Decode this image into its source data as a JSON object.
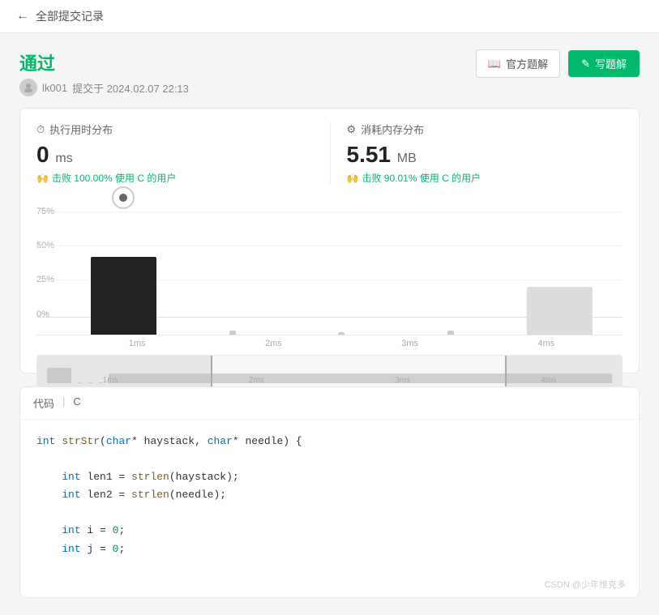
{
  "nav": {
    "back_label": "←",
    "title": "全部提交记录"
  },
  "status": {
    "label": "通过",
    "submitter": "lk001",
    "submitted_text": "提交于 2024.02.07 22:13"
  },
  "buttons": {
    "official_solution": "官方题解",
    "write_solution": "写题解"
  },
  "time_stats": {
    "section_label": "执行用时分布",
    "value": "0",
    "unit": "ms",
    "beat_text": "击败 100.00% 使用 C 的用户"
  },
  "memory_stats": {
    "section_label": "消耗内存分布",
    "value": "5.51",
    "unit": "MB",
    "beat_text": "击败 90.01% 使用 C 的用户"
  },
  "chart": {
    "y_labels": [
      "75%",
      "50%",
      "25%",
      "0%"
    ],
    "x_labels": [
      "1ms",
      "2ms",
      "3ms",
      "4ms"
    ],
    "bars": [
      {
        "height": 57,
        "type": "dark",
        "has_pointer": true
      },
      {
        "height": 3,
        "type": "gray"
      },
      {
        "height": 2,
        "type": "gray"
      },
      {
        "height": 3,
        "type": "gray"
      },
      {
        "height": 35,
        "type": "light-gray"
      }
    ],
    "mini_x_labels": [
      "1ms",
      "2ms",
      "3ms",
      "4ms"
    ]
  },
  "code": {
    "lang_label": "代码",
    "lang": "C",
    "lines": [
      {
        "tokens": [
          {
            "cls": "kw",
            "text": "int"
          },
          {
            "cls": "punc",
            "text": " strStr("
          },
          {
            "cls": "kw",
            "text": "char"
          },
          {
            "cls": "punc",
            "text": "* haystack, "
          },
          {
            "cls": "kw",
            "text": "char"
          },
          {
            "cls": "punc",
            "text": "* needle) {"
          }
        ]
      },
      {
        "tokens": []
      },
      {
        "tokens": [
          {
            "cls": "punc",
            "text": "    "
          },
          {
            "cls": "kw",
            "text": "int"
          },
          {
            "cls": "punc",
            "text": " len1 = "
          },
          {
            "cls": "fn",
            "text": "strlen"
          },
          {
            "cls": "punc",
            "text": "(haystack);"
          }
        ]
      },
      {
        "tokens": [
          {
            "cls": "punc",
            "text": "    "
          },
          {
            "cls": "kw",
            "text": "int"
          },
          {
            "cls": "punc",
            "text": " len2 = "
          },
          {
            "cls": "fn",
            "text": "strlen"
          },
          {
            "cls": "punc",
            "text": "(needle);"
          }
        ]
      },
      {
        "tokens": []
      },
      {
        "tokens": [
          {
            "cls": "punc",
            "text": "    "
          },
          {
            "cls": "kw",
            "text": "int"
          },
          {
            "cls": "punc",
            "text": " i = "
          },
          {
            "cls": "num",
            "text": "0"
          },
          {
            "cls": "punc",
            "text": ";"
          }
        ]
      },
      {
        "tokens": [
          {
            "cls": "punc",
            "text": "    "
          },
          {
            "cls": "kw",
            "text": "int"
          },
          {
            "cls": "punc",
            "text": " j = "
          },
          {
            "cls": "num",
            "text": "0"
          },
          {
            "cls": "punc",
            "text": ";"
          }
        ]
      }
    ]
  },
  "watermark": "CSDN @少年维克多"
}
